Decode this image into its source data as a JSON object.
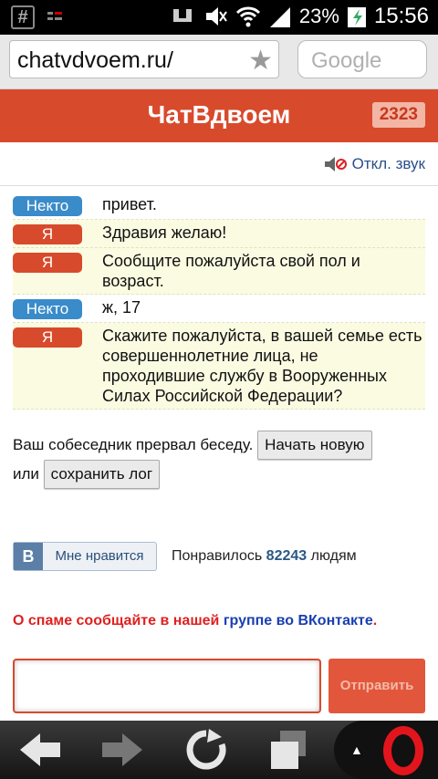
{
  "status": {
    "battery": "23%",
    "time": "15:56"
  },
  "browser": {
    "url": "chatvdvoem.ru/",
    "search_placeholder": "Google"
  },
  "header": {
    "title": "ЧатВдвоем",
    "online_count": "2323"
  },
  "sound_toggle": "Откл. звук",
  "messages": [
    {
      "sender": "Некто",
      "role": "stranger",
      "text": "привет."
    },
    {
      "sender": "Я",
      "role": "self",
      "text": "Здравия желаю!"
    },
    {
      "sender": "Я",
      "role": "self",
      "text": "Сообщите пожалуйста свой пол и возраст."
    },
    {
      "sender": "Некто",
      "role": "stranger",
      "text": "ж, 17"
    },
    {
      "sender": "Я",
      "role": "self",
      "text": "Скажите пожалуйста, в вашей семье есть совершеннолетние лица, не проходившие службу в Вооруженных Силах Российской Федерации?"
    }
  ],
  "ended": {
    "text": "Ваш собеседник прервал беседу.",
    "new_chat": "Начать новую",
    "or": "или",
    "save_log": "сохранить лог"
  },
  "like": {
    "logo": "В",
    "button": "Мне нравится",
    "prefix": "Понравилось",
    "count": "82243",
    "suffix": "людям"
  },
  "spam": {
    "red": "О спаме сообщайте в нашей",
    "link": "группе во ВКонтакте",
    "dot": "."
  },
  "composer": {
    "send": "Отправить"
  },
  "colors": {
    "accent": "#d84a2c",
    "stranger": "#3a8bc9",
    "self": "#d84a2c"
  }
}
